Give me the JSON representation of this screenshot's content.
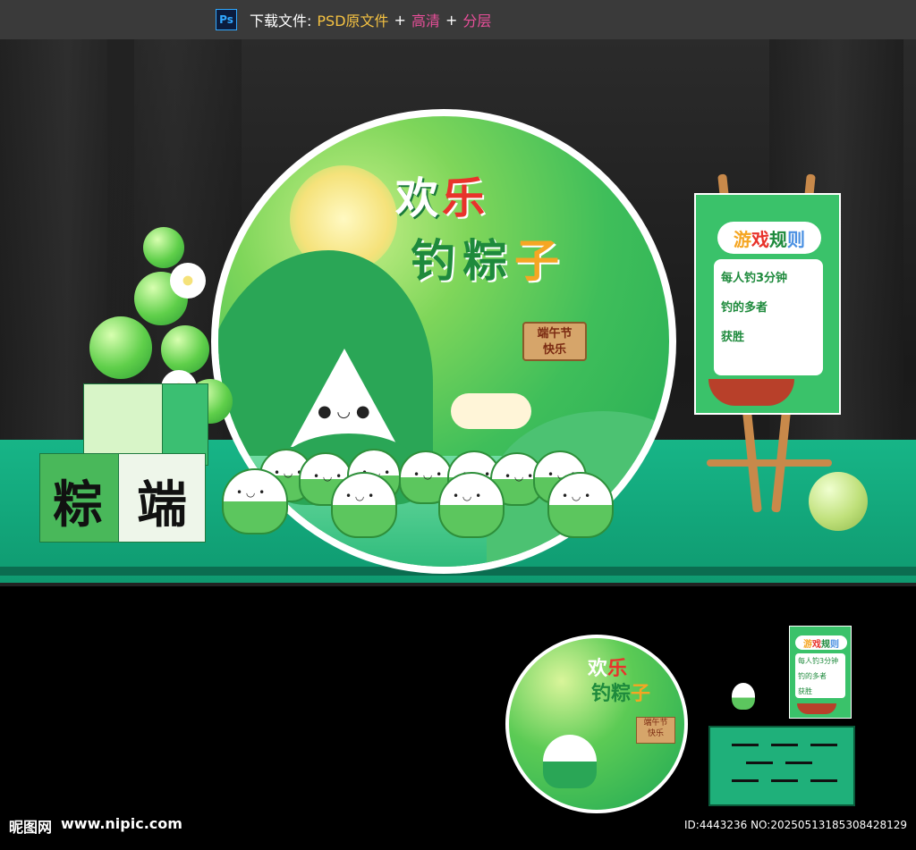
{
  "download_bar": {
    "ps_icon_label": "Ps",
    "download_label": "下载文件:",
    "psd_label": "PSD原文件",
    "plus1": "+",
    "hd_label": "高清",
    "plus2": "+",
    "layer_label": "分层"
  },
  "main_scene": {
    "title_part1": "欢",
    "title_part2": "乐",
    "title2_a": "钓",
    "title2_b": "粽",
    "title2_c": "子",
    "sign_line1": "端午节",
    "sign_line2": "快乐",
    "box_char_left": "粽",
    "box_char_right": "端",
    "board": {
      "title": [
        "游",
        "戏",
        "规",
        "则"
      ],
      "rules": [
        "每人钓3分钟",
        "钓的多者",
        "获胜"
      ]
    }
  },
  "preview": {
    "title_part1": "欢",
    "title_part2": "乐",
    "title2_a": "钓",
    "title2_b": "粽",
    "title2_c": "子",
    "sign_line1": "端午节",
    "sign_line2": "快乐",
    "board_title": [
      "游",
      "戏",
      "规",
      "则"
    ],
    "board_rules": [
      "每人钓3分钟",
      "钓的多者",
      "获胜"
    ]
  },
  "footer": {
    "site_name": "昵图网",
    "site_url": "www.nipic.com",
    "id_text": "ID:4443236 NO:20250513185308428129"
  },
  "colors": {
    "green_main": "#2aa656",
    "stage": "#17b587",
    "accent_red": "#e8332b",
    "accent_orange": "#f5a623"
  }
}
